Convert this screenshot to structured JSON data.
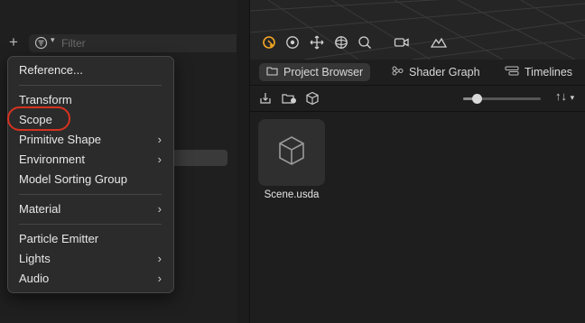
{
  "left_toolbar": {
    "add_symbol": "+",
    "filter_placeholder": "Filter",
    "filter_icon": "filter-lines-icon"
  },
  "viewport": {
    "tools": [
      "select-pointer-icon",
      "orbit-icon",
      "move-icon",
      "rotate-sphere-icon",
      "zoom-icon",
      "camera-sync-icon",
      "terrain-icon"
    ],
    "active_color": "#f5a623"
  },
  "tabs": [
    {
      "label": "Project Browser",
      "icon": "folder-icon",
      "active": true
    },
    {
      "label": "Shader Graph",
      "icon": "graph-nodes-icon",
      "active": false
    },
    {
      "label": "Timelines",
      "icon": "timeline-icon",
      "active": false
    }
  ],
  "browser_toolbar": {
    "icons": [
      "import-icon",
      "new-folder-icon",
      "add-object-icon"
    ],
    "zoom_level": 0.17,
    "sort_label": "↑↓"
  },
  "files": [
    {
      "name": "Scene.usda",
      "icon": "cube-icon"
    }
  ],
  "menu": {
    "items": [
      {
        "label": "Reference...",
        "submenu": false
      },
      {
        "label": "Transform",
        "submenu": false
      },
      {
        "label": "Scope",
        "submenu": false,
        "highlighted": true
      },
      {
        "label": "Primitive Shape",
        "submenu": true
      },
      {
        "label": "Environment",
        "submenu": true
      },
      {
        "label": "Model Sorting Group",
        "submenu": false
      },
      {
        "label": "Material",
        "submenu": true
      },
      {
        "label": "Particle Emitter",
        "submenu": false
      },
      {
        "label": "Lights",
        "submenu": true
      },
      {
        "label": "Audio",
        "submenu": true
      }
    ],
    "submenu_arrow": "›",
    "highlight_color": "#d6321f"
  }
}
